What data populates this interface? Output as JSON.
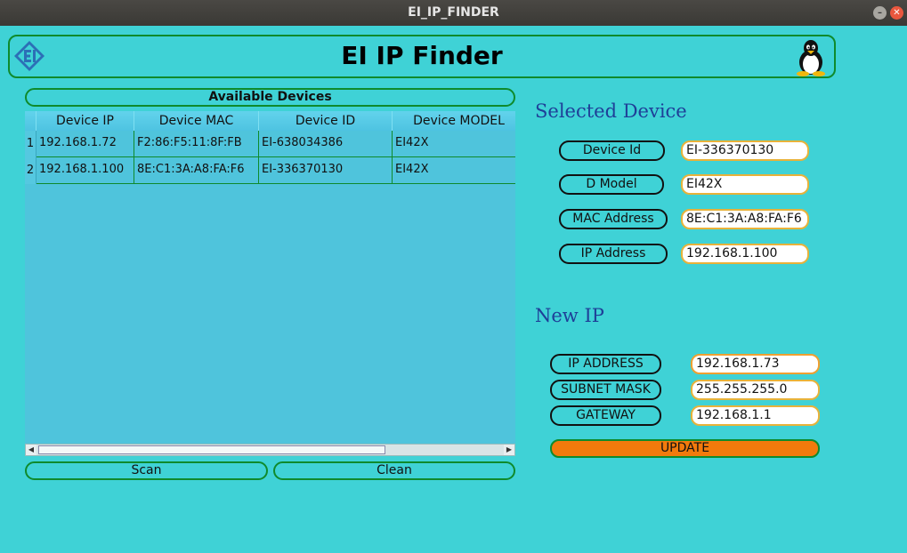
{
  "window": {
    "title": "EI_IP_FINDER"
  },
  "header": {
    "title": "EI IP Finder"
  },
  "devices_panel": {
    "title": "Available Devices",
    "columns": [
      "Device IP",
      "Device MAC",
      "Device ID",
      "Device MODEL"
    ],
    "rows": [
      {
        "num": "1",
        "ip": "192.168.1.72",
        "mac": "F2:86:F5:11:8F:FB",
        "id": "EI-638034386",
        "model": "EI42X"
      },
      {
        "num": "2",
        "ip": "192.168.1.100",
        "mac": "8E:C1:3A:A8:FA:F6",
        "id": "EI-336370130",
        "model": "EI42X"
      }
    ],
    "scan_label": "Scan",
    "clean_label": "Clean"
  },
  "selected_device": {
    "title": "Selected Device",
    "device_id_label": "Device Id",
    "device_id_value": "EI-336370130",
    "model_label": "D Model",
    "model_value": "EI42X",
    "mac_label": "MAC Address",
    "mac_value": "8E:C1:3A:A8:FA:F6",
    "ip_label": "IP Address",
    "ip_value": "192.168.1.100"
  },
  "new_ip": {
    "title": "New IP",
    "ip_label": "IP ADDRESS",
    "ip_value": "192.168.1.73",
    "subnet_label": "SUBNET MASK",
    "subnet_value": "255.255.255.0",
    "gateway_label": "GATEWAY",
    "gateway_value": "192.168.1.1",
    "update_label": "UPDATE"
  },
  "colors": {
    "background": "#3fd2d6",
    "accent_green": "#0f8a2c",
    "update_orange": "#f27a0c",
    "section_title_blue": "#1f3f98"
  },
  "icons": [
    "ei-logo-icon",
    "linux-tux-icon",
    "minimize-icon",
    "close-icon",
    "scroll-left-icon",
    "scroll-right-icon"
  ]
}
